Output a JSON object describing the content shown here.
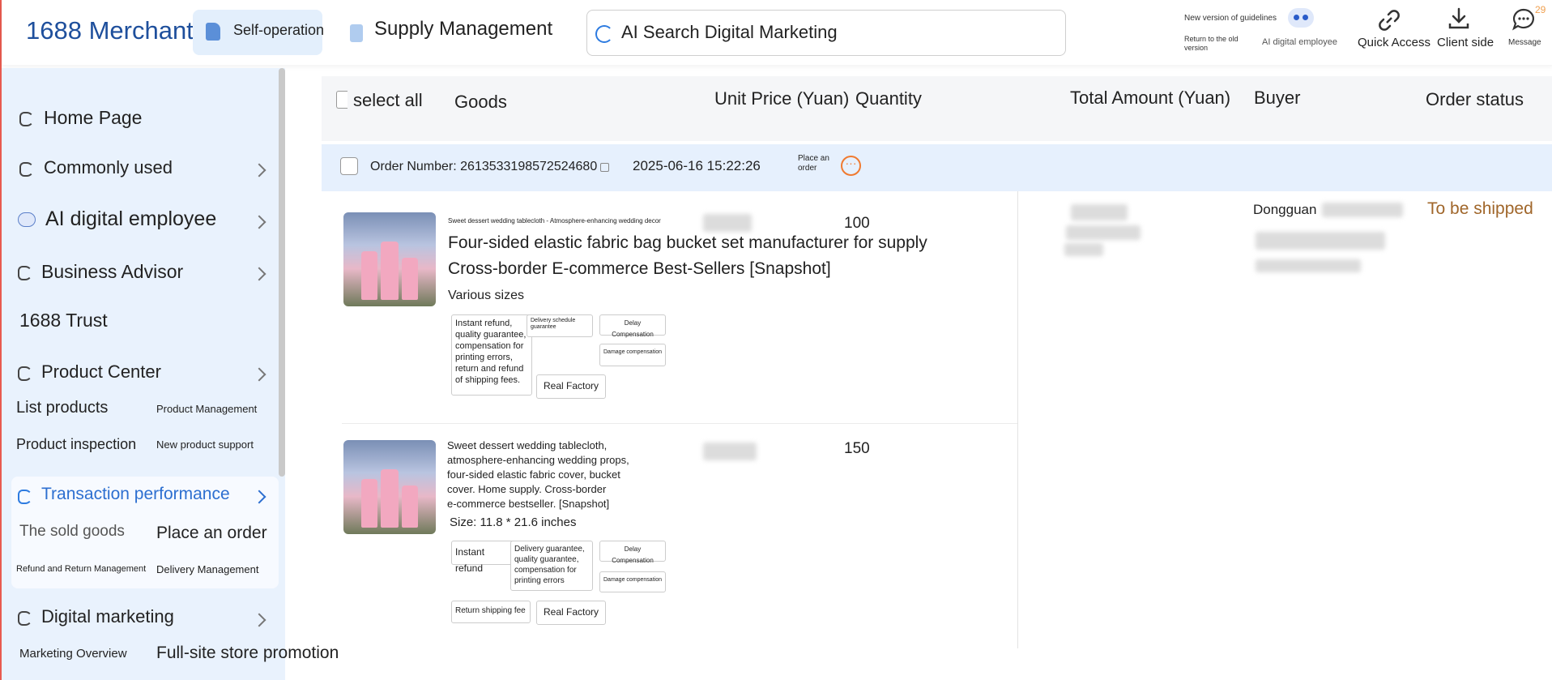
{
  "header": {
    "brand": "1688 Merchant",
    "self_operation": "Self-operation",
    "supply_management": "Supply Management",
    "search_placeholder": "AI Search Digital Marketing",
    "new_version": "New version of guidelines",
    "return_old": "Return to the old version",
    "ai_employee": "AI digital employee",
    "quick_access": "Quick Access",
    "client_side": "Client side",
    "message": "Message",
    "message_count": "29"
  },
  "sidebar": {
    "home": "Home Page",
    "commonly_used": "Commonly used",
    "ai_employee": "AI digital employee",
    "business_advisor": "Business Advisor",
    "trust": "1688 Trust",
    "product_center": "Product Center",
    "list_products": "List products",
    "product_management": "Product Management",
    "product_inspection": "Product inspection",
    "new_product_support": "New product support",
    "transaction_performance": "Transaction performance",
    "sold_goods": "The sold goods",
    "place_order": "Place an order",
    "refund_return": "Refund and Return Management",
    "delivery_management": "Delivery Management",
    "digital_marketing": "Digital marketing",
    "marketing_overview": "Marketing Overview",
    "full_site_promotion": "Full-site store promotion"
  },
  "table": {
    "select_all": "select all",
    "goods": "Goods",
    "unit_price": "Unit Price (Yuan)",
    "quantity": "Quantity",
    "total_amount": "Total Amount (Yuan)",
    "buyer": "Buyer",
    "order_status": "Order status"
  },
  "order": {
    "number": "Order Number: 2613533198572524680",
    "datetime": "2025-06-16 15:22:26",
    "place_order_label": "Place an order",
    "buyer_city": "Dongguan",
    "status": "To be shipped",
    "status_color": "#a0662a",
    "items": [
      {
        "small_title": "Sweet dessert wedding tablecloth - Atmosphere-enhancing wedding decor",
        "title_line1": "Four-sided elastic fabric bag bucket set manufacturer for supply",
        "title_line2": "Cross-border E-commerce Best-Sellers [Snapshot]",
        "spec": "Various sizes",
        "quantity": "100",
        "tag_refund": "Instant refund, quality guarantee, compensation for printing errors, return and refund of shipping fees.",
        "tag_delivery": "Delivery schedule guarantee",
        "tag_delay": "Delay Compensation",
        "tag_damage": "Damage compensation",
        "tag_factory": "Real Factory"
      },
      {
        "title_l1": "Sweet dessert wedding tablecloth,",
        "title_l2": "atmosphere-enhancing wedding props,",
        "title_l3": "four-sided elastic fabric cover, bucket",
        "title_l4": "cover. Home supply. Cross-border",
        "title_l5": "e-commerce bestseller. [Snapshot]",
        "spec": "Size: 11.8 * 21.6 inches",
        "quantity": "150",
        "tag_refund": "Instant refund",
        "tag_delivery": "Delivery guarantee, quality guarantee, compensation for printing errors",
        "tag_delay": "Delay Compensation",
        "tag_damage": "Damage compensation",
        "tag_shipping": "Return shipping fee",
        "tag_factory": "Real Factory"
      }
    ]
  }
}
